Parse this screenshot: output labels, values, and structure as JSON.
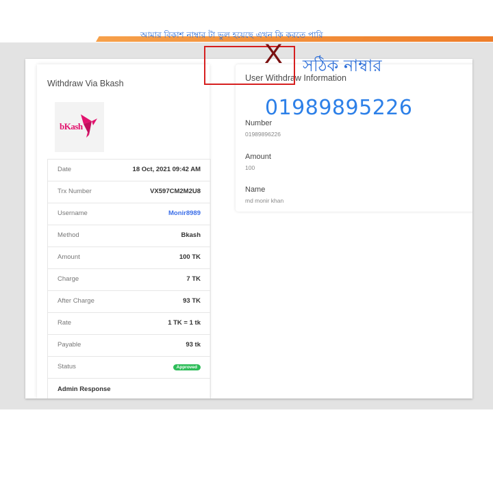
{
  "left_panel": {
    "title": "Withdraw Via Bkash",
    "logo_text": "bKash",
    "rows": [
      {
        "label": "Date",
        "value": "18 Oct, 2021 09:42 AM"
      },
      {
        "label": "Trx Number",
        "value": "VX597CM2M2U8"
      },
      {
        "label": "Username",
        "value": "Monir8989"
      },
      {
        "label": "Method",
        "value": "Bkash"
      },
      {
        "label": "Amount",
        "value": "100 TK"
      },
      {
        "label": "Charge",
        "value": "7 TK"
      },
      {
        "label": "After Charge",
        "value": "93 TK"
      },
      {
        "label": "Rate",
        "value": "1 TK = 1 tk"
      },
      {
        "label": "Payable",
        "value": "93 tk"
      },
      {
        "label": "Status",
        "value": "Approved"
      }
    ],
    "admin_response_label": "Admin Response"
  },
  "right_panel": {
    "title": "User Withdraw Information",
    "number_label": "Number",
    "number_value": "01989896226",
    "amount_label": "Amount",
    "amount_value": "100",
    "name_label": "Name",
    "name_value": "md monir khan"
  },
  "annotations": {
    "question": "আমার বিকাশ নাম্বার টা ভুল হয়েছে এখন কি করতে পারি",
    "wrong_mark": "X",
    "correct_label": "সঠিক নাম্বার",
    "correct_number": "01989895226"
  },
  "colors": {
    "accent_orange": "#ee7d2a",
    "bkash_pink": "#e2136e",
    "link_blue": "#3b6ee8",
    "status_green": "#2ebd59",
    "annotation_blue": "#2d6fd9",
    "annotation_red": "#d61e1e"
  }
}
